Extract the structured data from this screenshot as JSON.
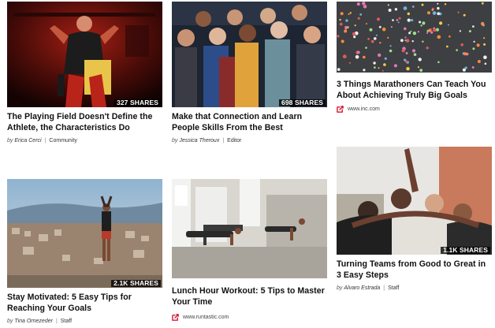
{
  "colors": {
    "accent": "#d0021b",
    "share_badge": "#000000"
  },
  "cards": [
    {
      "title": "The Playing Field Doesn't Define the Athlete, the Characteristics Do",
      "shares": "327 SHARES",
      "by": "by",
      "author": "Erica Cerci",
      "separator": "|",
      "category": "Community",
      "image": "athlete-red-gym-photo"
    },
    {
      "title": "Make that Connection and Learn People Skills From the Best",
      "shares": "698 SHARES",
      "by": "by",
      "author": "Jessica Theroux",
      "separator": "|",
      "category": "Editor",
      "image": "group-of-people-photo"
    },
    {
      "title": "3 Things Marathoners Can Teach You About Achieving Truly Big Goals",
      "source": "www.inc.com",
      "source_icon": "external-link-icon",
      "image": "aerial-crowd-runners-photo"
    },
    {
      "title": "Stay Motivated: 5 Easy Tips for Reaching Your Goals",
      "shares": "2.1K SHARES",
      "by": "by",
      "author": "Tina Ornezeder",
      "separator": "|",
      "category": "Staff",
      "image": "runner-overlooking-city-photo"
    },
    {
      "title": "Lunch Hour Workout: 5 Tips to Master Your Time",
      "source": "www.runtastic.com",
      "source_icon": "external-link-icon",
      "image": "pushup-workout-loft-photo"
    },
    {
      "title": "Turning Teams from Good to Great in 3 Easy Steps",
      "shares": "1.1K SHARES",
      "by": "by",
      "author": "Alvaro Estrada",
      "separator": "|",
      "category": "Staff",
      "image": "team-huddle-photo"
    }
  ]
}
